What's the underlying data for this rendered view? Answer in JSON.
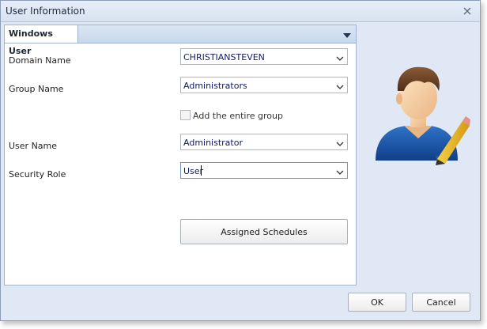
{
  "window": {
    "title": "User Information"
  },
  "tab": {
    "label": "Windows User"
  },
  "form": {
    "domain": {
      "label": "Domain Name",
      "value": "CHRISTIANSTEVEN"
    },
    "group": {
      "label": "Group Name",
      "value": "Administrators"
    },
    "entire_group": {
      "label": "Add the entire group",
      "checked": false
    },
    "user": {
      "label": "User Name",
      "value": "Administrator"
    },
    "role": {
      "label": "Security Role",
      "value": "User"
    }
  },
  "buttons": {
    "assigned_schedules": "Assigned Schedules",
    "ok": "OK",
    "cancel": "Cancel"
  },
  "icons": {
    "avatar": "user-edit-icon",
    "dropdown": "chevron-down-icon",
    "tab_menu": "triangle-down-icon"
  }
}
